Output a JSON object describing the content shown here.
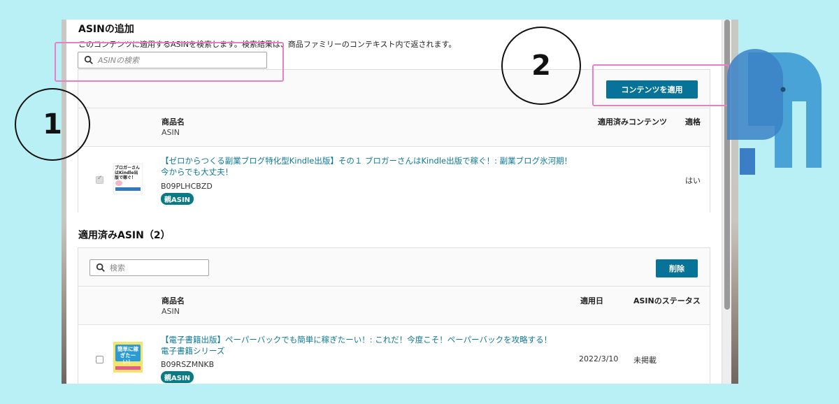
{
  "add_section": {
    "title": "ASINの追加",
    "description": "このコンテンツに適用するASINを検索します。検索結果は、商品ファミリーのコンテキスト内で返されます。",
    "search_placeholder": "ASINの検索",
    "apply_button": "コンテンツを適用",
    "columns": {
      "product": "商品名",
      "asin": "ASIN",
      "applied_content": "適用済みコンテンツ",
      "eligible": "適格"
    },
    "rows": [
      {
        "title_line1": "【ゼロからつくる副業ブログ特化型Kindle出版】その１ ブロガーさんはKindle出版で稼ぐ！: 副業ブログ氷河期！",
        "title_line2": "今からでも大丈夫！",
        "asin": "B09PLHCBZD",
        "badge": "親ASIN",
        "eligible": "はい",
        "checked": true,
        "thumb_text": "ブロガーさんはKindle出版で稼ぐ！"
      }
    ]
  },
  "applied_section": {
    "title": "適用済みASIN（2）",
    "search_placeholder": "検索",
    "delete_button": "削除",
    "columns": {
      "product": "商品名",
      "asin": "ASIN",
      "applied_date": "適用日",
      "status": "ASINのステータス"
    },
    "rows": [
      {
        "title_line1": "【電子書籍出版】ペーパーバックでも簡単に稼ぎたーい！: これだ！今度こそ！ペーパーバックを攻略する！",
        "title_line2": "電子書籍シリーズ",
        "asin": "B09RSZMNKB",
        "badge": "親ASIN",
        "date": "2022/3/10",
        "status": "未掲載",
        "checked": false,
        "thumb_text": "簡単に稼ぎたーい！"
      }
    ]
  },
  "annotations": {
    "step1": "1",
    "step2": "2"
  },
  "colors": {
    "accent": "#077398",
    "highlight": "#e87fc4",
    "background": "#b9f0f6"
  }
}
